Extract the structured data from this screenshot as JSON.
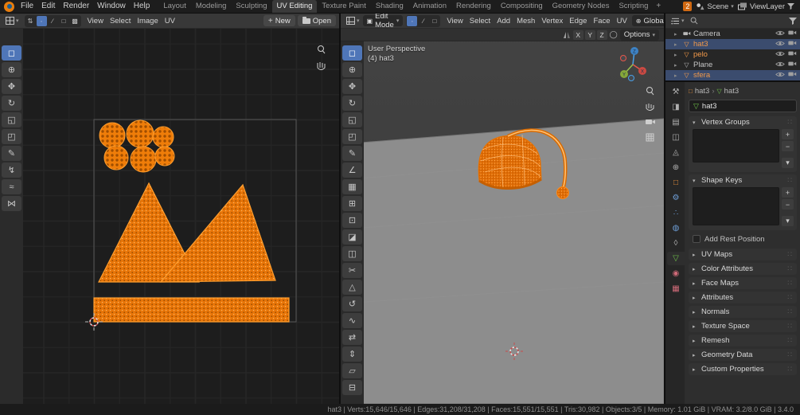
{
  "colors": {
    "accent": "#4f76b8",
    "selection_orange": "#f2994a",
    "island_orange": "#e87508",
    "highlight_row": "#3b4c6e"
  },
  "topbar": {
    "menus": [
      "File",
      "Edit",
      "Render",
      "Window",
      "Help"
    ],
    "workspaces": [
      "Layout",
      "Modeling",
      "Sculpting",
      "UV Editing",
      "Texture Paint",
      "Shading",
      "Animation",
      "Rendering",
      "Compositing",
      "Geometry Nodes",
      "Scripting"
    ],
    "active_workspace": "UV Editing",
    "new_workspace_button": "+",
    "scene_badge": "2",
    "scene": "Scene",
    "view_layer": "ViewLayer"
  },
  "uv_editor": {
    "menus": [
      "View",
      "Select",
      "Image",
      "UV"
    ],
    "new_label": "New",
    "open_label": "Open",
    "select_modes": {
      "modes": [
        "sync-select",
        "select-vertex",
        "select-edge",
        "select-face",
        "select-island"
      ],
      "active": "select-vertex"
    },
    "tools": [
      "select-box",
      "cursor",
      "move",
      "rotate",
      "scale",
      "transform",
      "annotate",
      "grab",
      "relax",
      "pinch"
    ],
    "active_tool": "select-box"
  },
  "viewport": {
    "mode": "Edit Mode",
    "menus": [
      "View",
      "Select",
      "Add",
      "Mesh",
      "Vertex",
      "Edge",
      "Face",
      "UV"
    ],
    "select_modes": {
      "modes": [
        "select-vertex",
        "select-edge",
        "select-face"
      ],
      "active": "select-vertex"
    },
    "orientation": "Global",
    "mirror_axes": [
      "X",
      "Y",
      "Z"
    ],
    "options_label": "Options",
    "overlay": {
      "line1": "User Perspective",
      "line2": "(4) hat3"
    },
    "gizmo_axes": [
      "X",
      "Y",
      "Z"
    ],
    "tools": [
      "select-box",
      "cursor",
      "move",
      "rotate",
      "scale",
      "transform",
      "annotate",
      "measure",
      "add-cube",
      "extrude",
      "inset",
      "bevel",
      "loop-cut",
      "knife",
      "poly-build",
      "spin",
      "smooth",
      "edge-slide",
      "shrink-fatten",
      "shear",
      "rip"
    ],
    "active_tool": "select-box"
  },
  "outliner": {
    "items": [
      {
        "name": "Camera",
        "icon": "camera",
        "selected": false,
        "highlighted": false
      },
      {
        "name": "hat3",
        "icon": "mesh",
        "selected": true,
        "highlighted": true
      },
      {
        "name": "pelo",
        "icon": "mesh",
        "selected": true,
        "highlighted": false
      },
      {
        "name": "Plane",
        "icon": "mesh",
        "selected": false,
        "highlighted": false
      },
      {
        "name": "sfera",
        "icon": "mesh",
        "selected": true,
        "highlighted": true
      }
    ]
  },
  "properties": {
    "tabs": [
      "tool",
      "render",
      "output",
      "view-layer",
      "scene",
      "world",
      "object",
      "modifiers",
      "particles",
      "physics",
      "constraints",
      "object-data",
      "material",
      "texture"
    ],
    "active_tab": "object-data",
    "breadcrumb": {
      "object": "hat3",
      "data": "hat3"
    },
    "name_field": "hat3",
    "sections": {
      "vertex_groups": "Vertex Groups",
      "shape_keys": "Shape Keys",
      "add_rest_position": "Add Rest Position",
      "collapsed": [
        "UV Maps",
        "Color Attributes",
        "Face Maps",
        "Attributes",
        "Normals",
        "Texture Space",
        "Remesh",
        "Geometry Data",
        "Custom Properties"
      ]
    }
  },
  "statusbar": {
    "stats": "hat3 | Verts:15,646/15,646 | Edges:31,208/31,208 | Faces:15,551/15,551 | Tris:30,982 | Objects:3/5 | Memory: 1.01 GiB | VRAM: 3.2/8.0 GiB | 3.4.0"
  },
  "icons": {
    "select-box": "◻",
    "cursor": "⊕",
    "move": "✥",
    "rotate": "↻",
    "scale": "◱",
    "transform": "◰",
    "annotate": "✎",
    "measure": "∠",
    "grab": "↯",
    "relax": "≈",
    "pinch": "⋈",
    "add-cube": "▦",
    "extrude": "⊞",
    "inset": "⊡",
    "bevel": "◪",
    "loop-cut": "◫",
    "knife": "✂",
    "poly-build": "△",
    "spin": "↺",
    "smooth": "∿",
    "edge-slide": "⇄",
    "shrink-fatten": "⇕",
    "shear": "▱",
    "rip": "⊟",
    "sync-select": "⇅",
    "select-vertex": "∙",
    "select-edge": "∕",
    "select-face": "□",
    "select-island": "▩"
  },
  "tab_icons": {
    "tool": "⚒",
    "render": "◨",
    "output": "▤",
    "view-layer": "◫",
    "scene": "◬",
    "world": "⊕",
    "object": "□",
    "modifiers": "⚙",
    "particles": "∴",
    "physics": "◍",
    "constraints": "◊",
    "object-data": "▽",
    "material": "◉",
    "texture": "▦"
  },
  "tab_colors": {
    "tool": "#b0b0b0",
    "render": "#b0b0b0",
    "output": "#b0b0b0",
    "view-layer": "#b0b0b0",
    "scene": "#b0b0b0",
    "world": "#b0b0b0",
    "object": "#e8913c",
    "modifiers": "#6f9fd8",
    "particles": "#6f9fd8",
    "physics": "#6f9fd8",
    "constraints": "#b0b0b0",
    "object-data": "#6fc14a",
    "material": "#cf6a78",
    "texture": "#cf6a78"
  }
}
